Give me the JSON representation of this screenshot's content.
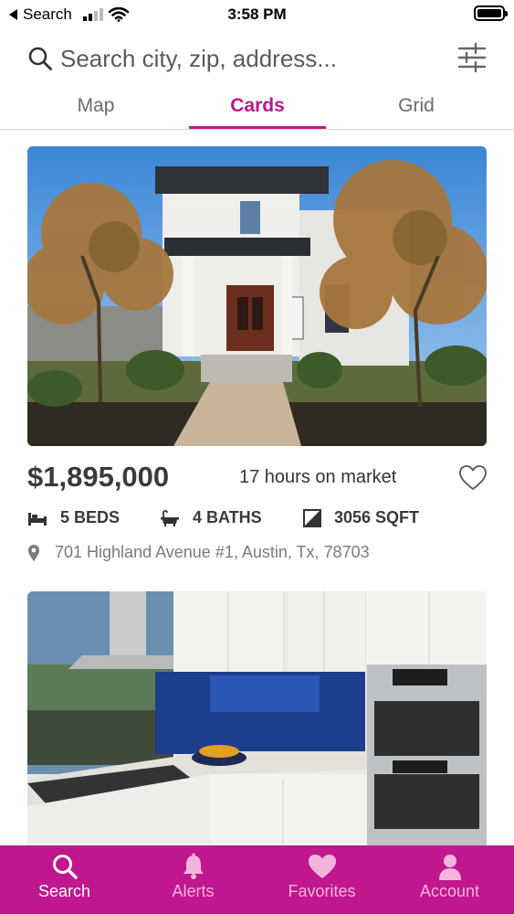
{
  "status_bar": {
    "back_label": "Search",
    "time": "3:58 PM"
  },
  "search": {
    "placeholder": "Search city, zip, address..."
  },
  "tabs": [
    {
      "label": "Map",
      "active": false
    },
    {
      "label": "Cards",
      "active": true
    },
    {
      "label": "Grid",
      "active": false
    }
  ],
  "listings": [
    {
      "price": "$1,895,000",
      "market_time": "17 hours on market",
      "beds": "5 BEDS",
      "baths": "4 BATHS",
      "sqft": "3056 SQFT",
      "address": "701  Highland Avenue #1, Austin, Tx, 78703",
      "favorited": false
    },
    {
      "photo": "kitchen"
    }
  ],
  "bottom_nav": [
    {
      "label": "Search",
      "icon": "search-icon",
      "active": true
    },
    {
      "label": "Alerts",
      "icon": "bell-icon",
      "active": false
    },
    {
      "label": "Favorites",
      "icon": "heart-icon",
      "active": false
    },
    {
      "label": "Account",
      "icon": "person-icon",
      "active": false
    }
  ],
  "colors": {
    "brand": "#c0168e",
    "nav_inactive_text": "#f2b6dc",
    "text_dark": "#3a3a3a",
    "text_muted": "#7a7a7a"
  }
}
